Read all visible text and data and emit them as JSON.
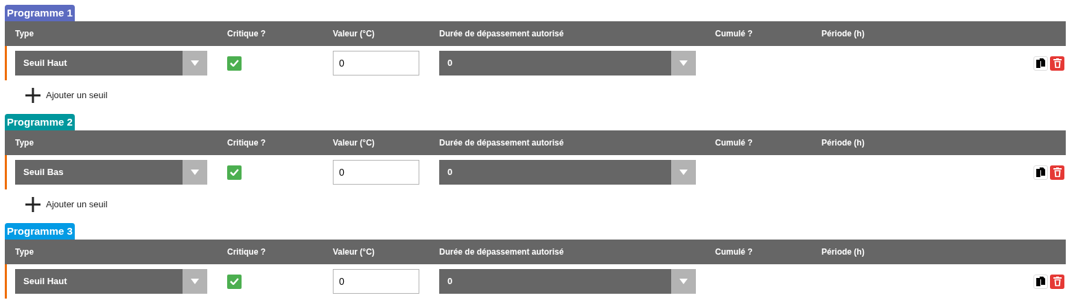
{
  "programmes": [
    {
      "title": "Programme 1",
      "color": "#5c6bc0",
      "columns": [
        "Type",
        "Critique ?",
        "Valeur (°C)",
        "Durée de dépassement autorisé",
        "Cumulé ?",
        "Période (h)"
      ],
      "rows": [
        {
          "type": "Seuil Haut",
          "critical": true,
          "value": "0",
          "duration": "0"
        }
      ],
      "add_label": "Ajouter un seuil"
    },
    {
      "title": "Programme 2",
      "color": "#00979d",
      "columns": [
        "Type",
        "Critique ?",
        "Valeur (°C)",
        "Durée de dépassement autorisé",
        "Cumulé ?",
        "Période (h)"
      ],
      "rows": [
        {
          "type": "Seuil Bas",
          "critical": true,
          "value": "0",
          "duration": "0"
        }
      ],
      "add_label": "Ajouter un seuil"
    },
    {
      "title": "Programme 3",
      "color": "#039be5",
      "columns": [
        "Type",
        "Critique ?",
        "Valeur (°C)",
        "Durée de dépassement autorisé",
        "Cumulé ?",
        "Période (h)"
      ],
      "rows": [
        {
          "type": "Seuil Haut",
          "critical": true,
          "value": "0",
          "duration": "0"
        }
      ]
    }
  ]
}
